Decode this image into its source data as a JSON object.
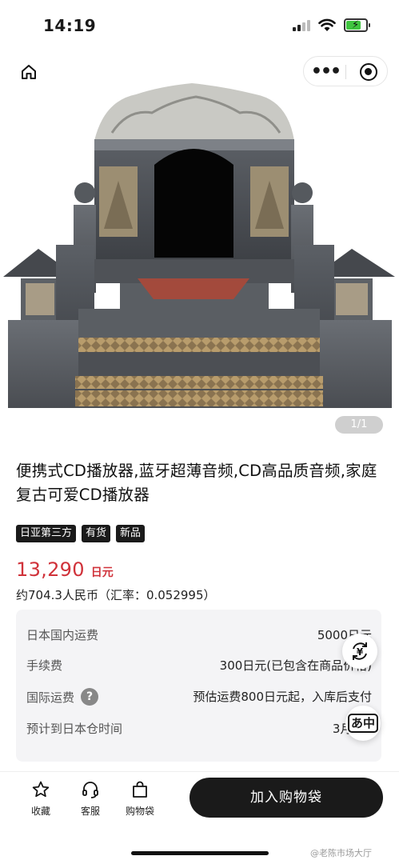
{
  "status_bar": {
    "time": "14:19",
    "battery_level": 0.75,
    "battery_color": "#3fc43f"
  },
  "nav": {
    "home_icon": "home-icon",
    "more_icon": "more-dots-icon",
    "close_icon": "mini-program-close-icon"
  },
  "image": {
    "page_indicator": "1/1"
  },
  "product": {
    "title": "便携式CD播放器,蓝牙超薄音频,CD高品质音频,家庭复古可爱CD播放器",
    "tags": [
      "日亚第三方",
      "有货",
      "新品"
    ],
    "price": "13,290",
    "price_unit": "日元",
    "rmb_estimate": "约704.3人民币（汇率：0.052995）",
    "price_color": "#d0323a"
  },
  "fees": [
    {
      "label": "日本国内运费",
      "value": "5000日元"
    },
    {
      "label": "手续费",
      "value": "300日元(已包含在商品价格)"
    },
    {
      "label": "国际运费",
      "value": "预估运费800日元起，入库后支付",
      "help": "?"
    },
    {
      "label": "预计到日本仓时间",
      "value": "3月2日"
    }
  ],
  "float_buttons": {
    "currency": "¥",
    "translate": "あ中"
  },
  "bottom_bar": {
    "favorite": "收藏",
    "service": "客服",
    "cart": "购物袋",
    "add_to_cart": "加入购物袋"
  },
  "watermark": "@老陈市场大厅"
}
